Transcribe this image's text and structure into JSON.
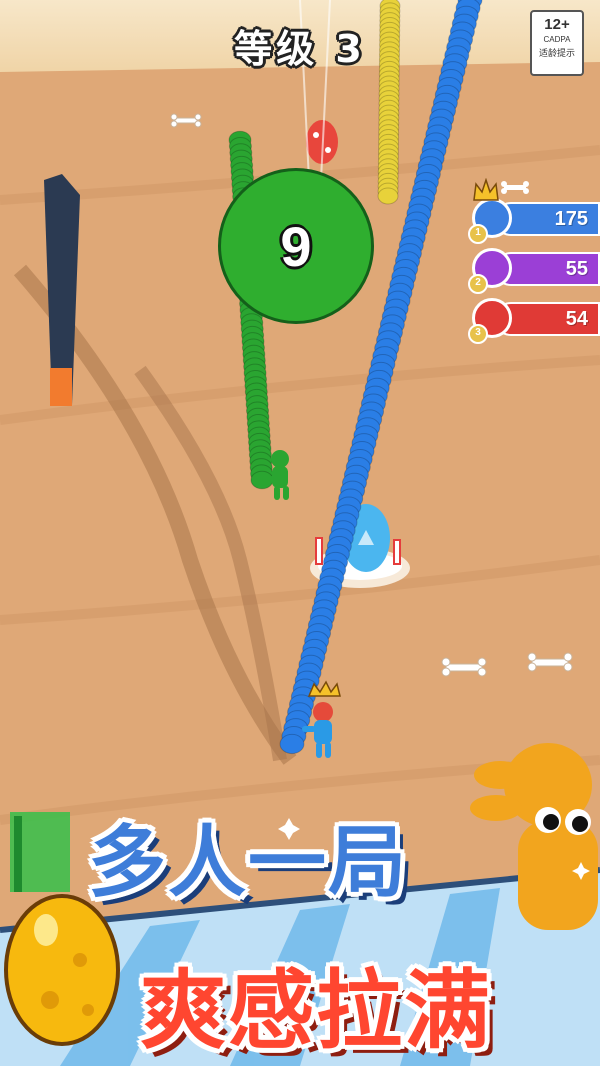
{
  "hud": {
    "level_label": "等级 3",
    "age_rating": {
      "rating": "12+",
      "org": "CADPA",
      "note": "适龄提示"
    }
  },
  "leaderboard": [
    {
      "rank": "1",
      "score": "175",
      "color": "#3b7fe0",
      "crowned": true
    },
    {
      "rank": "2",
      "score": "55",
      "color": "#9b3fd6",
      "crowned": false
    },
    {
      "rank": "3",
      "score": "54",
      "color": "#e03a36",
      "crowned": false
    }
  ],
  "countdown": {
    "value": "9"
  },
  "promo": {
    "line1": "多人一局",
    "line2": "爽感拉满"
  },
  "colors": {
    "sand": "#dca474",
    "player_chain": "#2a7ee6",
    "green_chain": "#2aa531",
    "yellow_chain": "#e8d23a"
  }
}
